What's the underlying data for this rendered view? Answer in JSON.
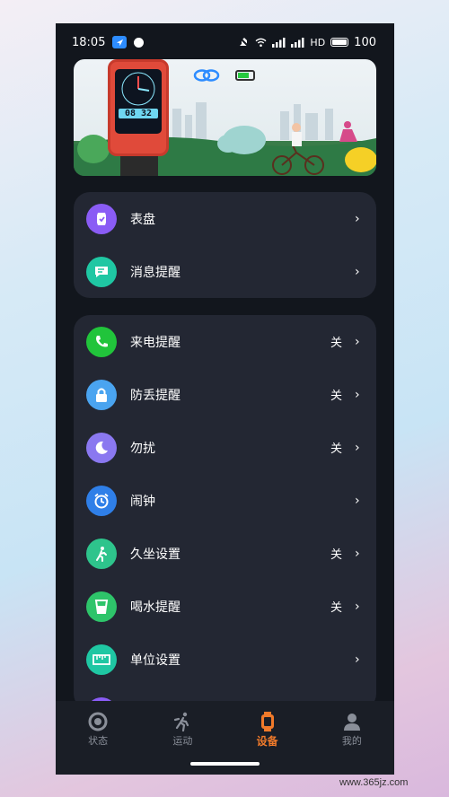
{
  "status_bar": {
    "time": "18:05",
    "network": "HD",
    "battery": "100"
  },
  "banner": {
    "watch_time": "08 32"
  },
  "card1": {
    "items": [
      {
        "label": "表盘",
        "value": "",
        "icon": "watch-face-icon",
        "color": "#8a5cf5"
      },
      {
        "label": "消息提醒",
        "value": "",
        "icon": "message-icon",
        "color": "#1fc7a3"
      }
    ]
  },
  "card2": {
    "items": [
      {
        "label": "来电提醒",
        "value": "关",
        "icon": "phone-icon",
        "color": "#21c43b"
      },
      {
        "label": "防丢提醒",
        "value": "关",
        "icon": "lock-icon",
        "color": "#4aa4f0"
      },
      {
        "label": "勿扰",
        "value": "关",
        "icon": "moon-icon",
        "color": "#8a78f0"
      },
      {
        "label": "闹钟",
        "value": "",
        "icon": "alarm-icon",
        "color": "#2f7fe8"
      },
      {
        "label": "久坐设置",
        "value": "关",
        "icon": "sedentary-icon",
        "color": "#2ec48c"
      },
      {
        "label": "喝水提醒",
        "value": "关",
        "icon": "cup-icon",
        "color": "#2ec46a"
      },
      {
        "label": "单位设置",
        "value": "",
        "icon": "ruler-icon",
        "color": "#1fc7a3"
      }
    ]
  },
  "tabs": [
    {
      "label": "状态",
      "icon": "status-icon",
      "active": false
    },
    {
      "label": "运动",
      "icon": "running-icon",
      "active": false
    },
    {
      "label": "设备",
      "icon": "device-icon",
      "active": true
    },
    {
      "label": "我的",
      "icon": "profile-icon",
      "active": false
    }
  ],
  "watermark": "www.365jz.com",
  "colors": {
    "accent": "#f07a2a",
    "card": "#232733",
    "background": "#12161d"
  }
}
